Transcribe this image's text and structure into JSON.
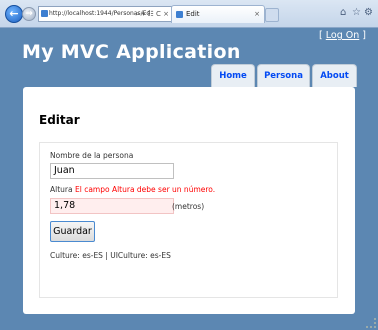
{
  "browser": {
    "address": "http://localhost:1944/Personas/Ed",
    "address_tools": "⌕ ▾ ☷ C ×",
    "tab_title": "Edit",
    "tab_close": "×",
    "back_glyph": "←",
    "forward_glyph": "→",
    "home_glyph": "⌂",
    "favorites_glyph": "☆",
    "tools_glyph": "⚙"
  },
  "header": {
    "title": "My MVC Application",
    "logon_open": "[ ",
    "logon_label": "Log On",
    "logon_close": " ]",
    "menu": [
      "Home",
      "Persona",
      "About"
    ]
  },
  "main": {
    "page_title": "Editar",
    "name_label": "Nombre de la persona",
    "name_value": "Juan",
    "height_label": "Altura",
    "height_error": "El campo Altura debe ser un número.",
    "height_value": "1,78",
    "height_units": "(metros)",
    "save_label": "Guardar",
    "culture_text": "Culture: es-ES | UICulture: es-ES"
  },
  "colors": {
    "page_bg": "#5c87b2",
    "error": "#ff0000",
    "menu_link": "#034af3"
  }
}
